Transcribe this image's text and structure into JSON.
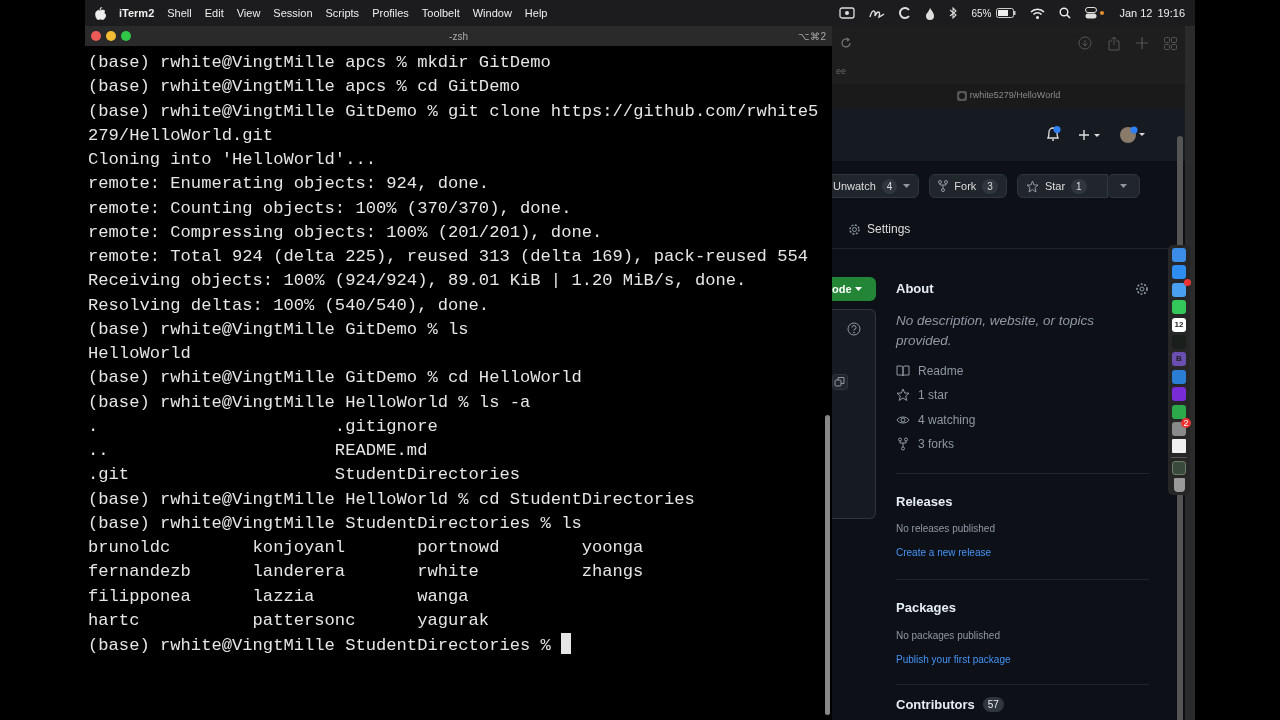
{
  "menu_bar": {
    "app": "iTerm2",
    "menus": [
      "Shell",
      "Edit",
      "View",
      "Session",
      "Scripts",
      "Profiles",
      "Toolbelt",
      "Window",
      "Help"
    ],
    "battery": "65%",
    "date": "Jan 12",
    "time": "19:16"
  },
  "terminal": {
    "title": "-zsh",
    "shortcut": "⌥⌘2",
    "lines": [
      {
        "kind": "text",
        "text": "(base) rwhite@VingtMille apcs % mkdir GitDemo"
      },
      {
        "kind": "text",
        "text": "(base) rwhite@VingtMille apcs % cd GitDemo"
      },
      {
        "kind": "text",
        "text": "(base) rwhite@VingtMille GitDemo % git clone https://github.com/rwhite5"
      },
      {
        "kind": "text",
        "text": "279/HelloWorld.git"
      },
      {
        "kind": "text",
        "text": "Cloning into 'HelloWorld'..."
      },
      {
        "kind": "text",
        "text": "remote: Enumerating objects: 924, done."
      },
      {
        "kind": "text",
        "text": "remote: Counting objects: 100% (370/370), done."
      },
      {
        "kind": "text",
        "text": "remote: Compressing objects: 100% (201/201), done."
      },
      {
        "kind": "text",
        "text": "remote: Total 924 (delta 225), reused 313 (delta 169), pack-reused 554"
      },
      {
        "kind": "text",
        "text": "Receiving objects: 100% (924/924), 89.01 KiB | 1.20 MiB/s, done."
      },
      {
        "kind": "text",
        "text": "Resolving deltas: 100% (540/540), done."
      },
      {
        "kind": "text",
        "text": "(base) rwhite@VingtMille GitDemo % ls"
      },
      {
        "kind": "text",
        "text": "HelloWorld"
      },
      {
        "kind": "text",
        "text": "(base) rwhite@VingtMille GitDemo % cd HelloWorld"
      },
      {
        "kind": "text",
        "text": "(base) rwhite@VingtMille HelloWorld % ls -a"
      },
      {
        "kind": "listing-wide",
        "cells": [
          ".",
          ".gitignore"
        ]
      },
      {
        "kind": "listing-wide",
        "cells": [
          "..",
          "README.md"
        ]
      },
      {
        "kind": "listing-wide",
        "cells": [
          ".git",
          "StudentDirectories"
        ]
      },
      {
        "kind": "text",
        "text": "(base) rwhite@VingtMille HelloWorld % cd StudentDirectories"
      },
      {
        "kind": "text",
        "text": "(base) rwhite@VingtMille StudentDirectories % ls"
      },
      {
        "kind": "listing",
        "cells": [
          "brunoldc",
          "konjoyanl",
          "portnowd",
          "yoonga"
        ]
      },
      {
        "kind": "listing",
        "cells": [
          "fernandezb",
          "landerera",
          "rwhite",
          "zhangs"
        ]
      },
      {
        "kind": "listing",
        "cells": [
          "filipponea",
          "lazzia",
          "wanga"
        ]
      },
      {
        "kind": "listing",
        "cells": [
          "hartc",
          "pattersonc",
          "yagurak"
        ]
      },
      {
        "kind": "cursor",
        "text": "(base) rwhite@VingtMille StudentDirectories %"
      }
    ]
  },
  "browser": {
    "tab_fragment": "ee",
    "tab_title": "rwhite5279/HelloWorld",
    "repo_actions": [
      {
        "kind": "menu",
        "label": "Unwatch",
        "count": "4"
      },
      {
        "kind": "fork",
        "label": "Fork",
        "count": "3"
      },
      {
        "kind": "star",
        "label": "Star",
        "count": "1"
      }
    ],
    "settings_tab": "Settings",
    "code_button": "ode",
    "about": {
      "title": "About",
      "description": "No description, website, or topics provided.",
      "stats": [
        {
          "kind": "book",
          "text": "Readme"
        },
        {
          "kind": "star",
          "text": "1 star"
        },
        {
          "kind": "eye",
          "text": "4 watching"
        },
        {
          "kind": "fork",
          "text": "3 forks"
        }
      ]
    },
    "sections": [
      {
        "title": "Releases",
        "note": "No releases published",
        "link": "Create a new release"
      },
      {
        "title": "Packages",
        "note": "No packages published",
        "link": "Publish your first package"
      }
    ],
    "contributors": {
      "title": "Contributors",
      "count": "57"
    }
  },
  "dock": {
    "apps": [
      {
        "kind": "app",
        "color": "#3b8de8",
        "alert": false
      },
      {
        "kind": "app",
        "color": "#2f8df0",
        "alert": false
      },
      {
        "kind": "app",
        "color": "#4aa0f0",
        "alert": true
      },
      {
        "kind": "app",
        "color": "#34c759",
        "alert": false
      },
      {
        "kind": "app",
        "color": "#ffffff",
        "alert": false,
        "label": "12"
      },
      {
        "kind": "app",
        "color": "#1b1f1c",
        "alert": false
      },
      {
        "kind": "app",
        "color": "#6a4fb0",
        "alert": false,
        "label": "B"
      },
      {
        "kind": "app",
        "color": "#2a7fd4",
        "alert": false
      },
      {
        "kind": "app",
        "color": "#7a2bd8",
        "alert": false
      },
      {
        "kind": "app",
        "color": "#2ca94b",
        "alert": false
      },
      {
        "kind": "app",
        "color": "#8a8a8a",
        "alert": true,
        "badge": "2"
      },
      {
        "kind": "document",
        "color": "#f0f0f0",
        "alert": false
      },
      {
        "kind": "minimized",
        "color": "#3a4a3a",
        "alert": false
      },
      {
        "kind": "trash",
        "color": "#9a9a9a",
        "alert": false
      }
    ]
  }
}
